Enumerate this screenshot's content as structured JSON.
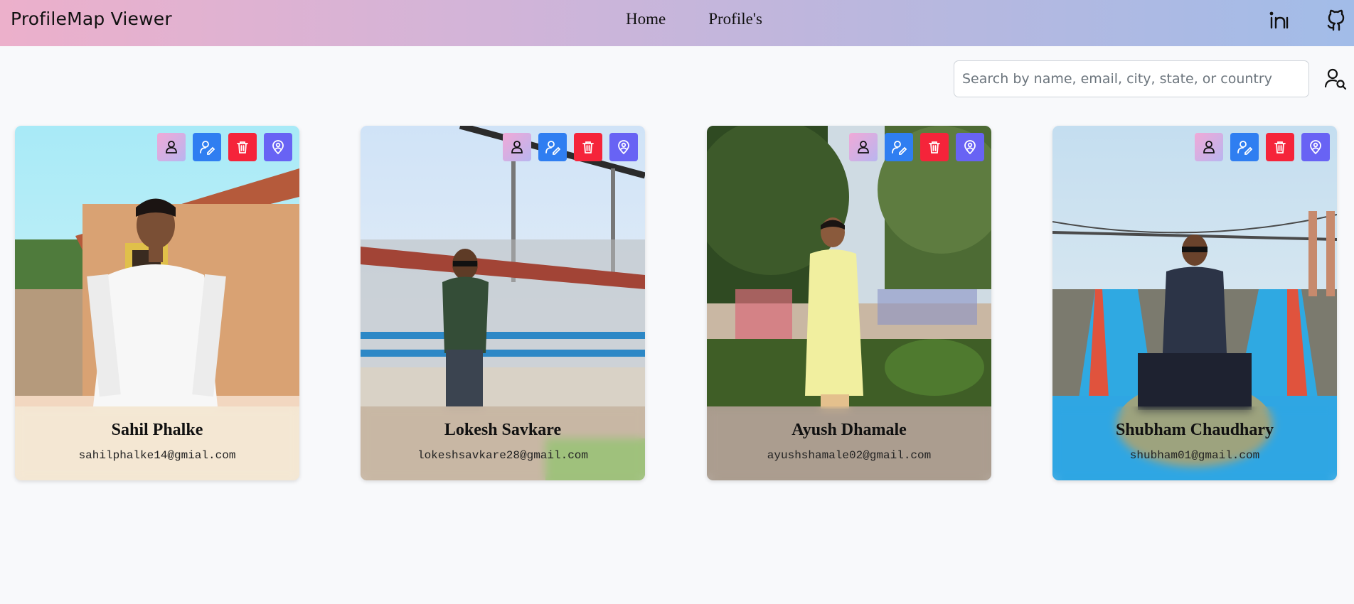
{
  "navbar": {
    "brand": "ProfileMap Viewer",
    "links": [
      "Home",
      "Profile's"
    ],
    "icons": [
      "linkedin-icon",
      "github-icon"
    ]
  },
  "search": {
    "placeholder": "Search by name, email, city, state, or country",
    "value": ""
  },
  "profiles": [
    {
      "name": "Sahil Phalke",
      "email": "sahilphalke14@gmial.com"
    },
    {
      "name": "Lokesh Savkare",
      "email": "lokeshsavkare28@gmail.com"
    },
    {
      "name": "Ayush Dhamale",
      "email": "ayushshamale02@gmail.com"
    },
    {
      "name": "Shubham Chaudhary",
      "email": "shubham01@gmail.com"
    }
  ],
  "card_actions": [
    "view-profile",
    "edit-profile",
    "delete-profile",
    "show-on-map"
  ],
  "colors": {
    "view": "#f0a9d7",
    "edit": "#2f7ef1",
    "delete": "#f5243a",
    "map": "#6863f4"
  }
}
